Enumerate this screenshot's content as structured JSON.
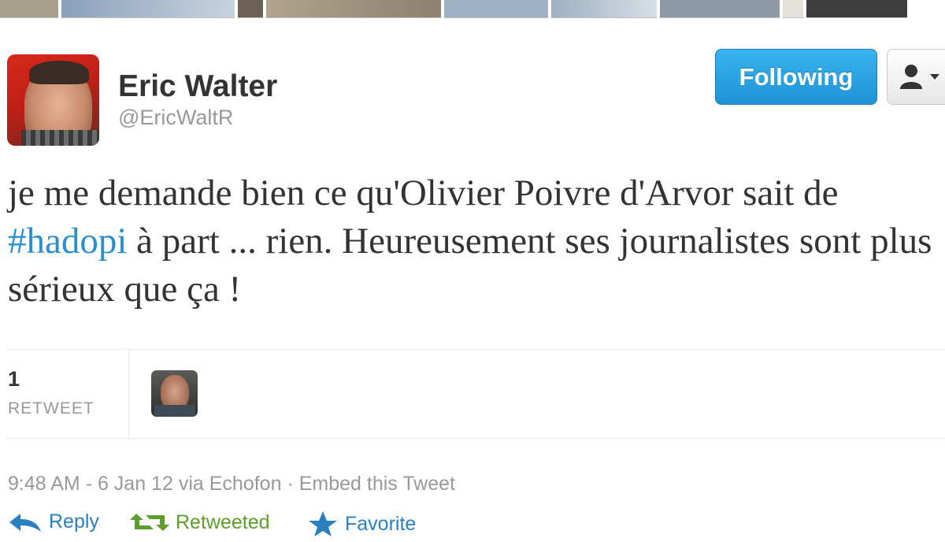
{
  "header": {
    "name": "Eric Walter",
    "handle": "@EricWaltR",
    "follow_label": "Following",
    "user_menu_icon": "user-dropdown-icon"
  },
  "tweet": {
    "text_before": "je me demande bien ce qu'Olivier Poivre d'Arvor sait de ",
    "hashtag": "#hadopi",
    "text_after": " à part ... rien. Heureusement ses journalistes sont plus sérieux que ça !"
  },
  "stats": {
    "retweet_count": "1",
    "retweet_label": "RETWEET"
  },
  "meta": {
    "timestamp": "9:48 AM - 6 Jan 12",
    "via_prefix": "via",
    "client": "Echofon",
    "separator": "·",
    "embed_label": "Embed this Tweet"
  },
  "actions": {
    "reply_label": "Reply",
    "retweet_label": "Retweeted",
    "favorite_label": "Favorite"
  },
  "colors": {
    "accent": "#2a8fd0",
    "retweeted": "#5c9e2e",
    "follow_button": "#1f93d6"
  }
}
